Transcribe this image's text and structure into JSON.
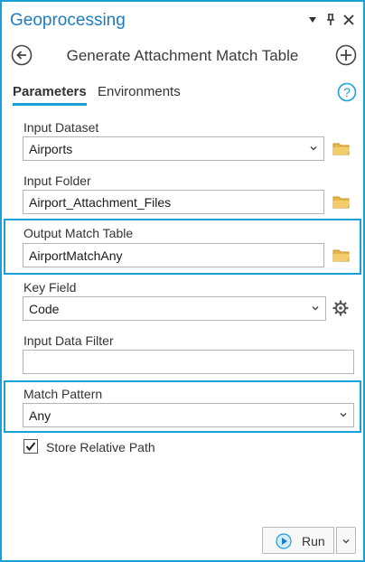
{
  "pane": {
    "title": "Geoprocessing"
  },
  "tool": {
    "title": "Generate Attachment Match Table"
  },
  "tabs": {
    "parameters": "Parameters",
    "environments": "Environments"
  },
  "params": {
    "input_dataset": {
      "label": "Input Dataset",
      "value": "Airports"
    },
    "input_folder": {
      "label": "Input Folder",
      "value": "Airport_Attachment_Files"
    },
    "output_match_table": {
      "label": "Output Match Table",
      "value": "AirportMatchAny"
    },
    "key_field": {
      "label": "Key Field",
      "value": "Code"
    },
    "input_data_filter": {
      "label": "Input Data Filter",
      "value": ""
    },
    "match_pattern": {
      "label": "Match Pattern",
      "value": "Any"
    },
    "store_relative_path": {
      "label": "Store Relative Path",
      "checked": true
    }
  },
  "footer": {
    "run_label": "Run"
  },
  "colors": {
    "accent": "#1aa0d8",
    "title": "#1f7cc0",
    "folder": "#e8b84a"
  },
  "icons": [
    "menu-arrow-icon",
    "pin-icon",
    "close-icon",
    "back-arrow-icon",
    "add-icon",
    "help-icon",
    "folder-icon",
    "gear-icon",
    "chevron-down-icon",
    "play-icon"
  ]
}
